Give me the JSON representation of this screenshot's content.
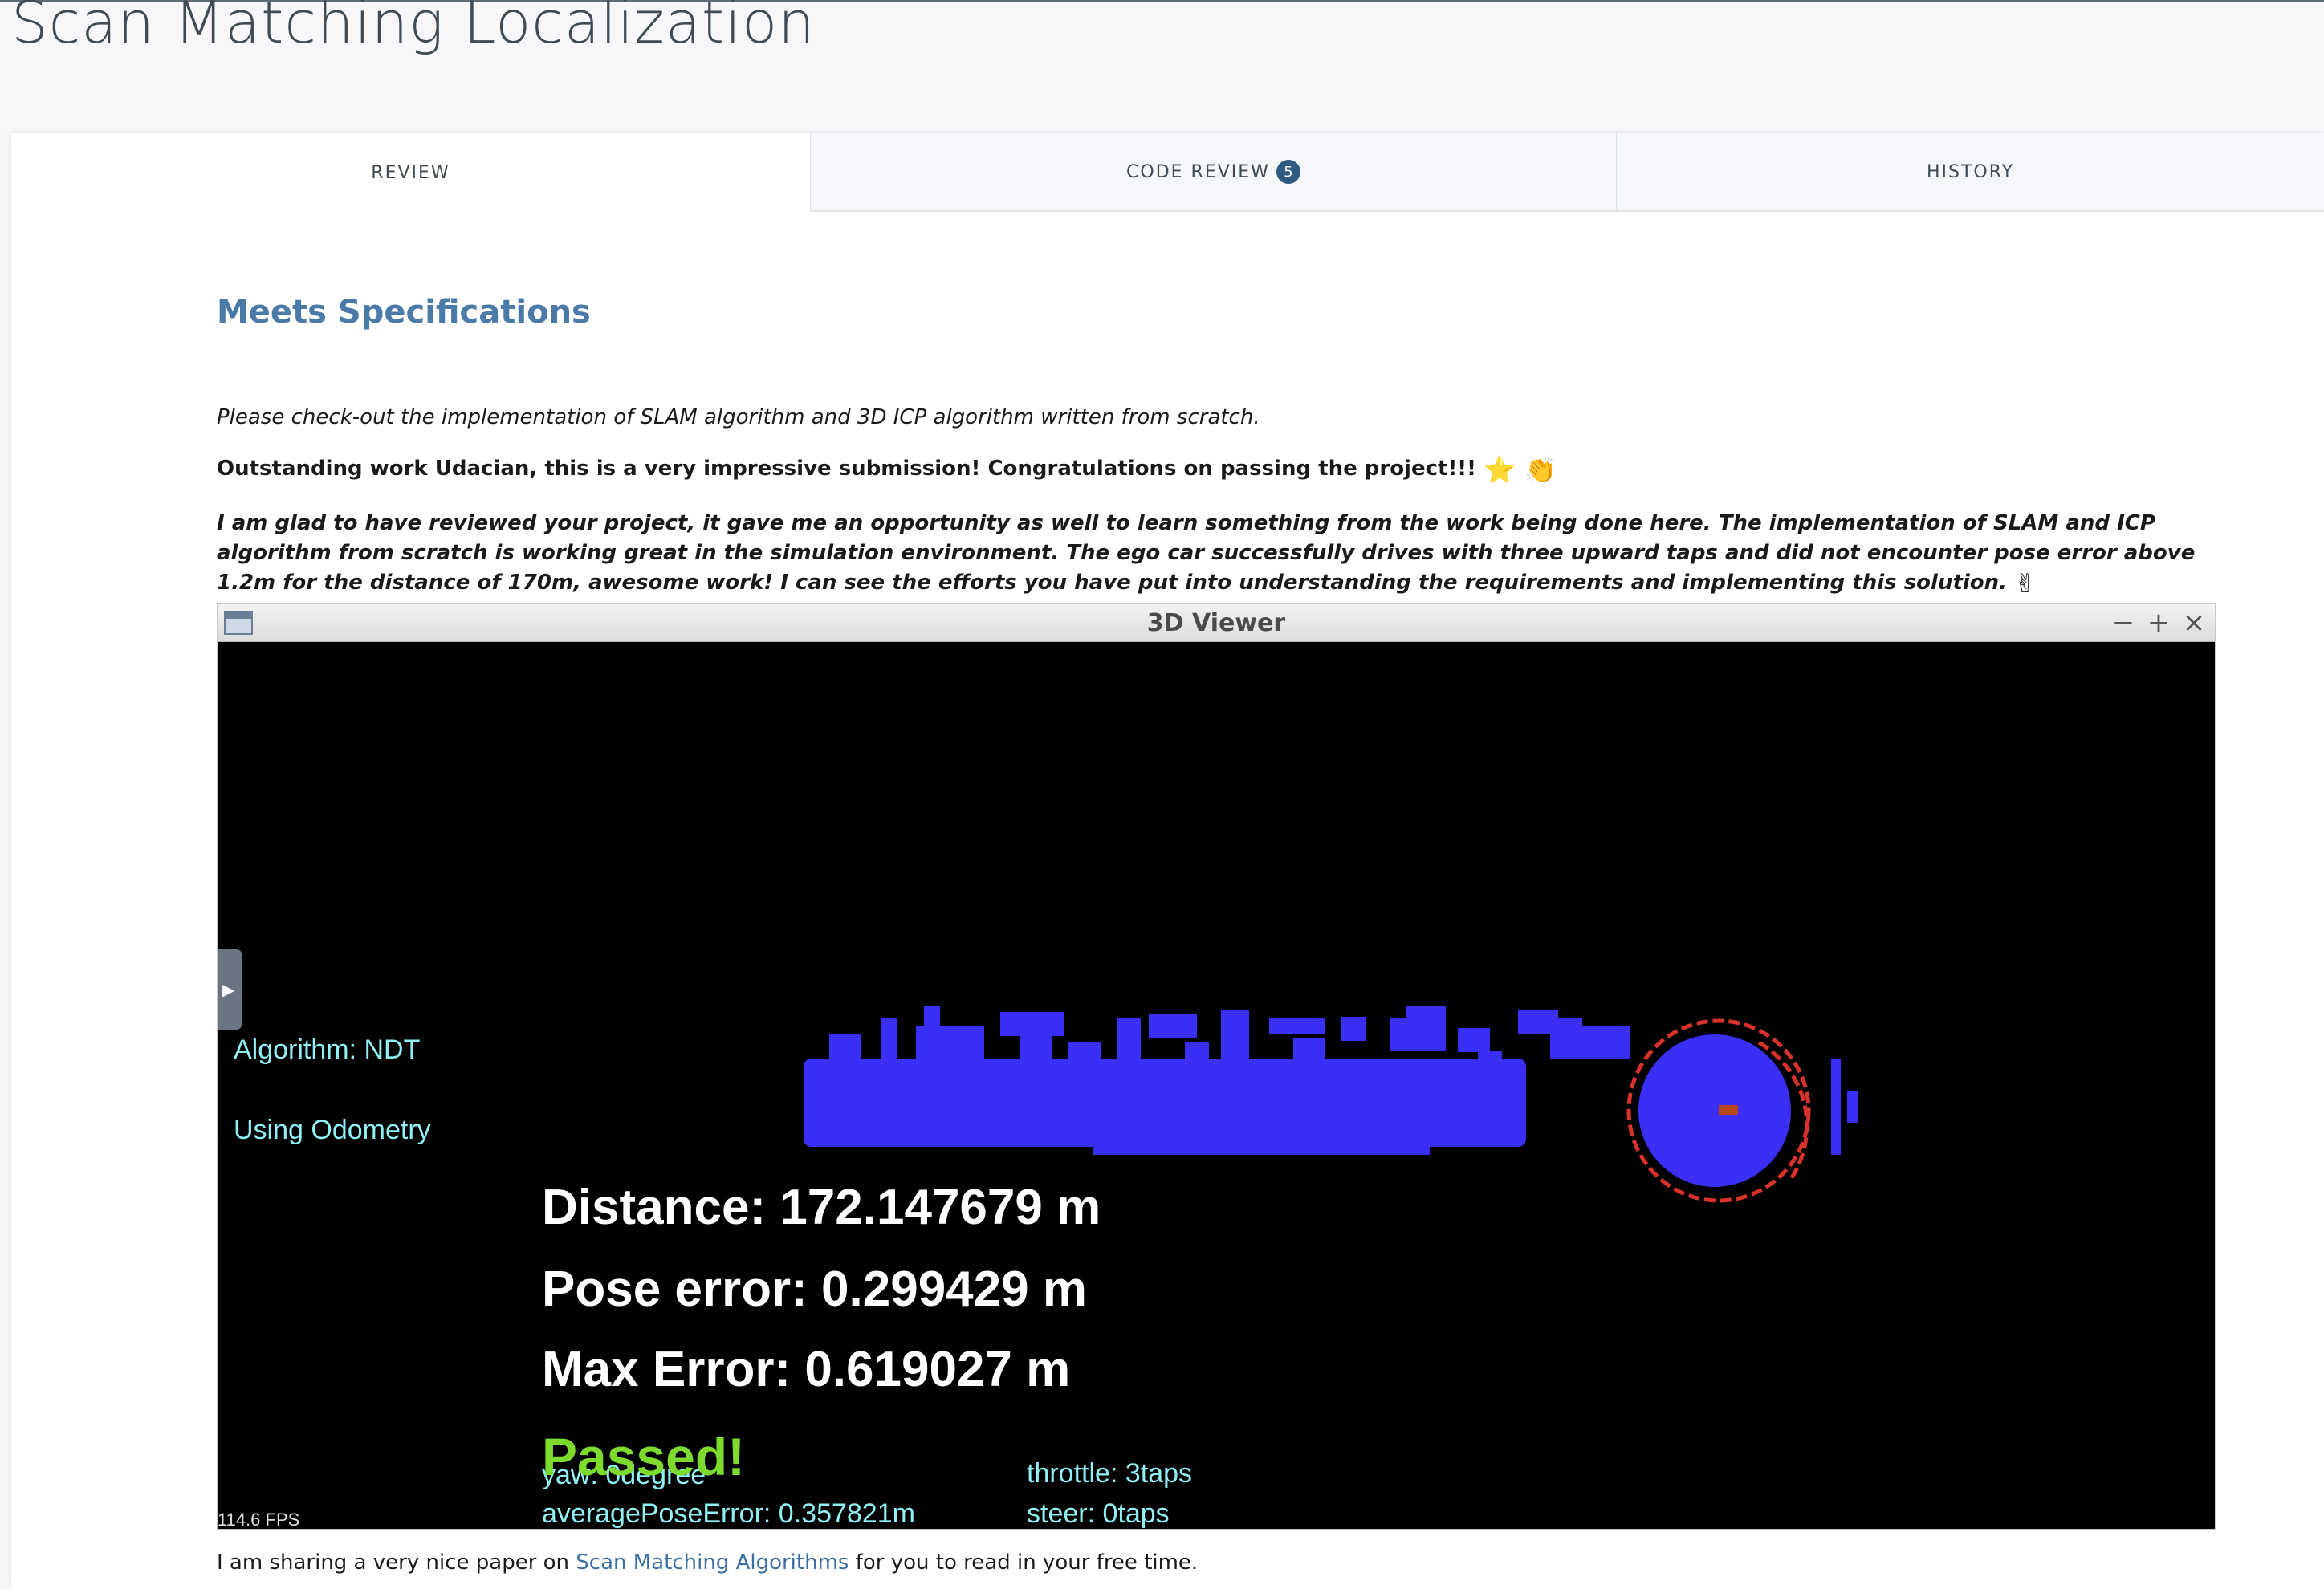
{
  "page": {
    "title": "Scan Matching Localization"
  },
  "tabs": [
    {
      "label": "REVIEW",
      "active": true
    },
    {
      "label": "CODE REVIEW",
      "badge": "5"
    },
    {
      "label": "HISTORY"
    }
  ],
  "review": {
    "heading": "Meets Specifications",
    "intro": "Please check-out the implementation of SLAM algorithm and 3D ICP algorithm written from scratch.",
    "praise": "Outstanding work Udacian, this is a very impressive submission! Congratulations on passing the project!!!",
    "praise_emojis": "⭐ 👏",
    "detail": "I am glad to have reviewed your project, it gave me an opportunity as well to learn something from the work being done here. The implementation of SLAM and ICP algorithm from scratch is working great in the simulation environment. The ego car successfully drives with three upward taps and did not encounter pose error above 1.2m for the distance of 170m, awesome work! I can see the efforts you have put into understanding the requirements and implementing this solution.",
    "detail_emoji": "✌",
    "sharing_prefix": "I am sharing a very nice paper on ",
    "sharing_link": "Scan Matching Algorithms",
    "sharing_suffix": " for you to read in your free time."
  },
  "viewer": {
    "title": "3D Viewer",
    "controls": {
      "minimize": "−",
      "maximize": "+",
      "close": "×"
    },
    "algorithm": "Algorithm: NDT",
    "odometry": "Using Odometry",
    "distance": "Distance:  172.147679 m",
    "pose_error": "Pose error: 0.299429 m",
    "max_error": "Max Error: 0.619027 m",
    "status": "Passed!",
    "yaw": "yaw: 0degree",
    "average_pose_error": "averagePoseError: 0.357821m",
    "throttle": "throttle: 3taps",
    "steer": "steer: 0taps",
    "fps": "114.6 FPS",
    "colors": {
      "pointcloud": "#3b2ff5",
      "scan": "#d8322a",
      "text": "#ffffff",
      "status": "#7ddb2e",
      "info": "#8ff0f5"
    }
  }
}
